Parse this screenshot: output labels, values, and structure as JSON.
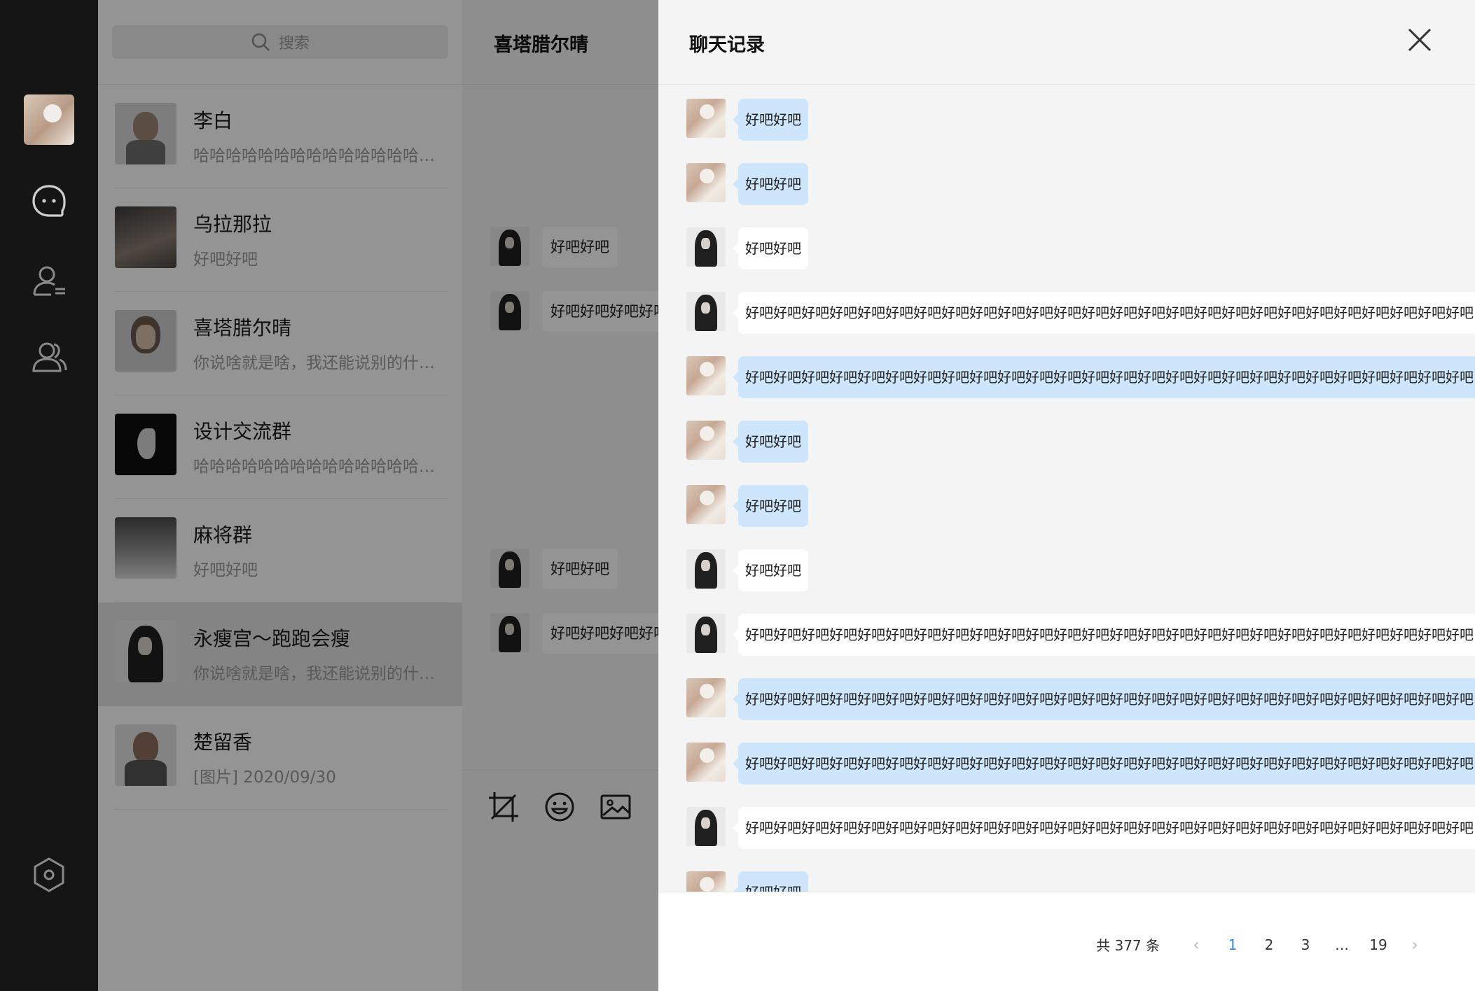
{
  "search": {
    "placeholder": "搜索"
  },
  "contacts": [
    {
      "name": "李白",
      "preview": "哈哈哈哈哈哈哈哈哈哈哈哈哈哈哈哈哈哈哈",
      "avatar": "man-cap"
    },
    {
      "name": "乌拉那拉",
      "preview": "好吧好吧",
      "avatar": "woman-dark"
    },
    {
      "name": "喜塔腊尔晴",
      "preview": "你说啥就是啥，我还能说别的什么呢",
      "avatar": "man-portrait"
    },
    {
      "name": "设计交流群",
      "preview": "哈哈哈哈哈哈哈哈哈哈哈哈哈哈哈哈哈哈哈",
      "avatar": "woman-profile"
    },
    {
      "name": "麻将群",
      "preview": "好吧好吧",
      "avatar": "smoke"
    },
    {
      "name": "永瘦宫～跑跑会瘦",
      "preview": "你说啥就是啥，我还能说别的什么呢",
      "avatar": "woman-hair",
      "active": true
    },
    {
      "name": "楚留香",
      "preview": "[图片] 2020/09/30",
      "avatar": "man-beard"
    }
  ],
  "conversation": {
    "title": "喜塔腊尔晴",
    "messages": [
      "好吧好吧",
      "好吧好吧好吧好吧好吧",
      "好吧好吧",
      "好吧好吧好吧好吧好吧"
    ],
    "tools": [
      "crop-icon",
      "emoji-icon",
      "image-icon"
    ]
  },
  "history": {
    "title": "聊天记录",
    "messages": [
      {
        "sender": "me",
        "text": "好吧好吧"
      },
      {
        "sender": "me",
        "text": "好吧好吧"
      },
      {
        "sender": "other",
        "text": "好吧好吧"
      },
      {
        "sender": "other",
        "text": "好吧好吧好吧好吧好吧好吧好吧好吧好吧好吧好吧好吧好吧好吧好吧好吧好吧好吧好吧好吧好吧好吧好吧好吧好吧好吧"
      },
      {
        "sender": "me",
        "text": "好吧好吧好吧好吧好吧好吧好吧好吧好吧好吧好吧好吧好吧好吧好吧好吧好吧好吧好吧好吧好吧好吧好吧好吧好吧好吧"
      },
      {
        "sender": "me",
        "text": "好吧好吧"
      },
      {
        "sender": "me",
        "text": "好吧好吧"
      },
      {
        "sender": "other",
        "text": "好吧好吧"
      },
      {
        "sender": "other",
        "text": "好吧好吧好吧好吧好吧好吧好吧好吧好吧好吧好吧好吧好吧好吧好吧好吧好吧好吧好吧好吧好吧好吧好吧好吧好吧好吧"
      },
      {
        "sender": "me",
        "text": "好吧好吧好吧好吧好吧好吧好吧好吧好吧好吧好吧好吧好吧好吧好吧好吧好吧好吧好吧好吧好吧好吧好吧好吧好吧好吧"
      },
      {
        "sender": "me",
        "text": "好吧好吧好吧好吧好吧好吧好吧好吧好吧好吧好吧好吧好吧好吧好吧好吧好吧好吧好吧好吧好吧好吧好吧好吧好吧好吧"
      },
      {
        "sender": "other",
        "text": "好吧好吧好吧好吧好吧好吧好吧好吧好吧好吧好吧好吧好吧好吧好吧好吧好吧好吧好吧好吧好吧好吧好吧好吧好吧好吧"
      },
      {
        "sender": "me",
        "text": "好吧好吧"
      }
    ],
    "pagination": {
      "total": "共 377 条",
      "pages": [
        "1",
        "2",
        "3",
        "…",
        "19"
      ],
      "current": "1",
      "prev": "‹",
      "next": "›"
    }
  },
  "colors": {
    "accent": "#2d8cf0",
    "my_bubble": "#cde6fb",
    "other_bubble": "#ffffff",
    "rail": "#151515"
  }
}
